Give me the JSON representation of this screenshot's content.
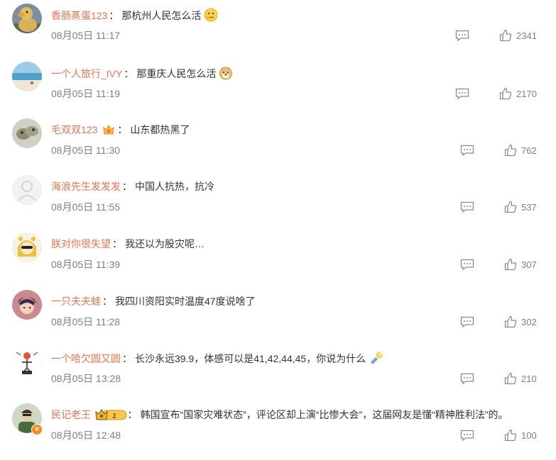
{
  "comments": [
    {
      "user": "香肠蒸蛋123",
      "sep": "：",
      "text": "那杭州人民怎么活",
      "time": "08月05日 11:17",
      "likes": "2341"
    },
    {
      "user": "一个人旅行_IVY",
      "sep": "：",
      "text": "那重庆人民怎么活",
      "time": "08月05日 11:19",
      "likes": "2170"
    },
    {
      "user": "毛双双123",
      "sep": "：",
      "text": "山东都热黑了",
      "time": "08月05日 11:30",
      "likes": "762"
    },
    {
      "user": "海浪先生发发发",
      "sep": "：",
      "text": "中国人抗热，抗冷",
      "time": "08月05日 11:55",
      "likes": "537"
    },
    {
      "user": "朕对你很失望",
      "sep": "：",
      "text": "我还以为股灾呢…",
      "time": "08月05日 11:39",
      "likes": "307"
    },
    {
      "user": "一只夫夫蛙",
      "sep": "：",
      "text": "我四川资阳实时温度47度说啥了",
      "time": "08月05日 11:28",
      "likes": "302"
    },
    {
      "user": "一个哈欠圆又圆",
      "sep": "：",
      "text": "长沙永远39.9，体感可以是41,42,44,45，你说为什么",
      "time": "08月05日 13:28",
      "likes": "210"
    },
    {
      "user": "民记老王",
      "sep": "：",
      "text": "韩国宣布“国家灾难状态”，评论区却上演“比惨大会”，这届网友是懂“精神胜利法”的。",
      "time": "08月05日 12:48",
      "likes": "100",
      "badge_text": "1"
    }
  ],
  "colors": {
    "username": "#eb7350",
    "text": "#333333",
    "meta": "#808080",
    "verified": "#f78a1c"
  }
}
